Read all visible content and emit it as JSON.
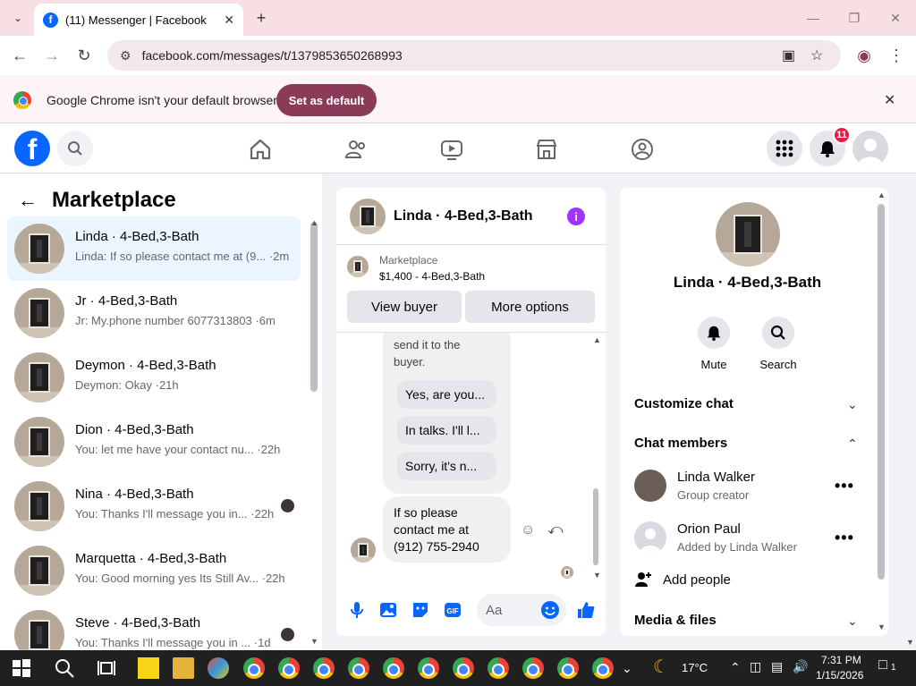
{
  "browser": {
    "tab_title": "(11) Messenger | Facebook",
    "url": "facebook.com/messages/t/1379853650268993",
    "infobar_text": "Google Chrome isn't your default browser",
    "set_default_label": "Set as default"
  },
  "fb": {
    "notif_badge": "11"
  },
  "left": {
    "title": "Marketplace",
    "conversations": [
      {
        "name": "Linda · 4-Bed,3-Bath",
        "preview": "Linda: If so please contact me at (9...",
        "time": "·2m"
      },
      {
        "name": "Jr · 4-Bed,3-Bath",
        "preview": "Jr: My.phone number 6077313803",
        "time": "·6m"
      },
      {
        "name": "Deymon · 4-Bed,3-Bath",
        "preview": "Deymon: Okay",
        "time": "·21h"
      },
      {
        "name": "Dion · 4-Bed,3-Bath",
        "preview": "You: let me have your contact nu...",
        "time": "·22h"
      },
      {
        "name": "Nina · 4-Bed,3-Bath",
        "preview": "You: Thanks I'll message you in...",
        "time": "·22h"
      },
      {
        "name": "Marquetta · 4-Bed,3-Bath",
        "preview": "You: Good morning yes Its Still Av...",
        "time": "·22h"
      },
      {
        "name": "Steve · 4-Bed,3-Bath",
        "preview": "You: Thanks I'll message you in ...",
        "time": "·1d"
      }
    ]
  },
  "chat": {
    "name": "Linda · 4-Bed,3-Bath",
    "listing_label": "Marketplace",
    "listing_title": "$1,400 - 4-Bed,3-Bath",
    "view_buyer": "View buyer",
    "more_options": "More options",
    "msg_partial": "send it to the buyer.",
    "quick_replies": [
      "Yes, are you...",
      "In talks. I'll l...",
      "Sorry, it's n..."
    ],
    "last_message": "If so please contact me at (912) 755-2940",
    "composer_placeholder": "Aa"
  },
  "info": {
    "name": "Linda · 4-Bed,3-Bath",
    "mute": "Mute",
    "search": "Search",
    "customize": "Customize chat",
    "members_title": "Chat members",
    "members": [
      {
        "name": "Linda Walker",
        "role": "Group creator"
      },
      {
        "name": "Orion Paul",
        "role": "Added by Linda Walker"
      }
    ],
    "add_people": "Add people",
    "media": "Media & files"
  },
  "taskbar": {
    "weather": "17°C",
    "time": "7:31 PM",
    "date": "1/15/2026",
    "notif_count": "1"
  },
  "colors": {
    "fb_blue": "#0866ff",
    "accent_purple": "#a033ff",
    "chrome_tab_bg": "#f7dfe4",
    "set_default_bg": "#8b3a57"
  }
}
